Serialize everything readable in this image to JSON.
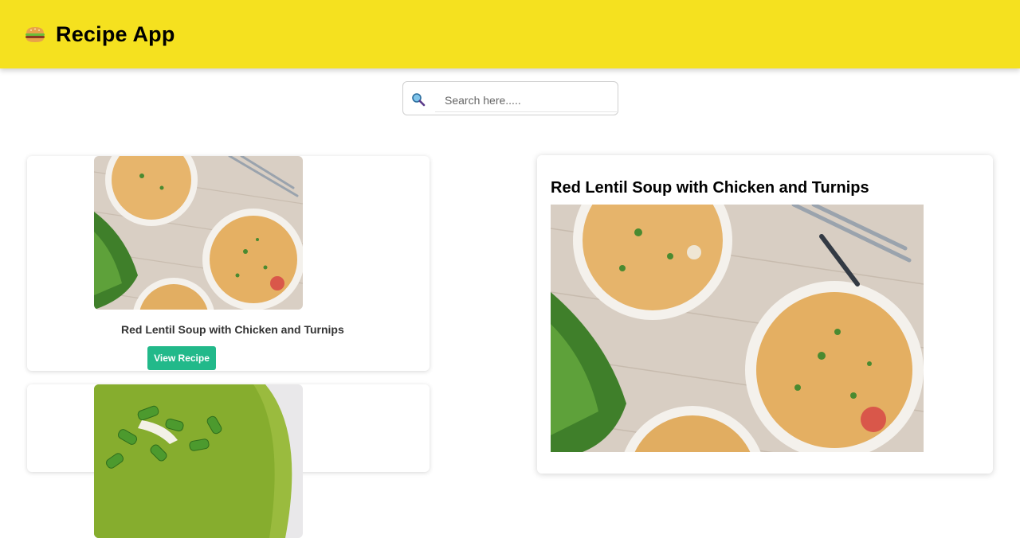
{
  "app": {
    "title": "Recipe App",
    "logo_icon": "burger-icon",
    "header_color": "#f5e11f"
  },
  "search": {
    "placeholder": "Search here.....",
    "value": "",
    "icon": "search-icon"
  },
  "recipes": [
    {
      "title": "Red Lentil Soup with Chicken and Turnips",
      "button_label": "View Recipe"
    },
    {
      "title": "",
      "button_label": ""
    }
  ],
  "detail": {
    "title": "Red Lentil Soup with Chicken and Turnips"
  },
  "colors": {
    "accent_button": "#22b98a"
  }
}
